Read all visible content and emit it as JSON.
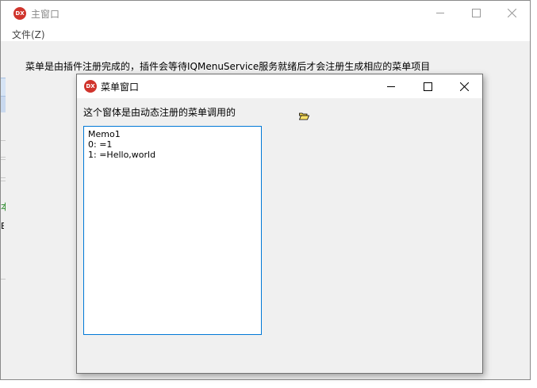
{
  "main_window": {
    "title": "主窗口",
    "menu": {
      "file_label": "文件(Z)"
    },
    "info_text": "菜单是由插件注册完成的，插件会等待IQMenuService服务就绪后才会注册生成相应的菜单项目",
    "fragment_char_1": "本",
    "fragment_char_2": "E"
  },
  "child_window": {
    "title": "菜单窗口",
    "caption_label": "这个窗体是由动态注册的菜单调用的",
    "memo": {
      "lines": [
        "Memo1",
        "0: =1",
        "1: =Hello,world"
      ]
    }
  },
  "colors": {
    "accent": "#0078d7",
    "app_icon": "#d0342c",
    "window_bg": "#f0f0f0",
    "titlebar_bg": "#ffffff"
  },
  "icons": {
    "app": "app-icon",
    "minimize": "minimize-icon",
    "maximize": "maximize-icon",
    "close": "close-icon",
    "folder": "folder-open-icon"
  }
}
